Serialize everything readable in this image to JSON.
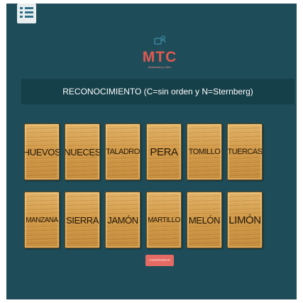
{
  "menu": {
    "icon": "menu-list-icon"
  },
  "logo": {
    "text": "MTC",
    "subtitle": "Multitasking Cafes",
    "icon": "logo-figure-icon",
    "color": "#e1594f"
  },
  "task": {
    "title": "RECONOCIMIENTO (C=sin orden y N=Sternberg)"
  },
  "cards": [
    {
      "label": "HUEVOS"
    },
    {
      "label": "NUECES"
    },
    {
      "label": "TALADRO"
    },
    {
      "label": "PERA"
    },
    {
      "label": "TOMILLO"
    },
    {
      "label": "TUERCAS"
    },
    {
      "label": "MANZANA"
    },
    {
      "label": "SIERRA"
    },
    {
      "label": "JAMÓN"
    },
    {
      "label": "MARTILLO"
    },
    {
      "label": "MELÓN"
    },
    {
      "label": "LIMÓN"
    }
  ],
  "actions": {
    "submit_label": "COMPROBAR"
  },
  "colors": {
    "background": "#1e4d59",
    "title_bar": "#153f49",
    "accent": "#e46b63",
    "card_wood": "#d79f4c"
  }
}
